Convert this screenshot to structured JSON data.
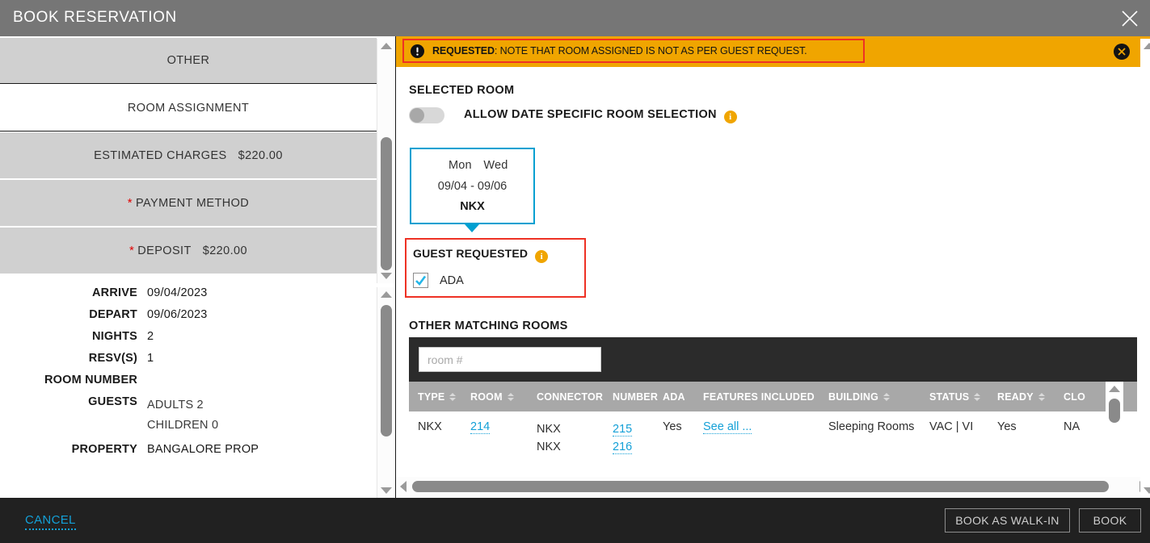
{
  "window": {
    "title": "BOOK RESERVATION",
    "close_icon": "close-icon"
  },
  "left_panel": {
    "sections": [
      {
        "label": "OTHER",
        "style": "grey",
        "amount": "",
        "required": false
      },
      {
        "label": "ROOM ASSIGNMENT",
        "style": "white",
        "amount": "",
        "required": false
      },
      {
        "label": "ESTIMATED CHARGES",
        "style": "grey",
        "amount": "$220.00",
        "required": false
      },
      {
        "label": "PAYMENT METHOD",
        "style": "grey",
        "amount": "",
        "required": true
      },
      {
        "label": "DEPOSIT",
        "style": "grey",
        "amount": "$220.00",
        "required": true
      }
    ],
    "details": [
      {
        "label": "ARRIVE",
        "value": "09/04/2023"
      },
      {
        "label": "DEPART",
        "value": "09/06/2023"
      },
      {
        "label": "NIGHTS",
        "value": "2"
      },
      {
        "label": "RESV(S)",
        "value": "1"
      },
      {
        "label": "ROOM NUMBER",
        "value": ""
      },
      {
        "label": "GUESTS",
        "value": "ADULTS 2",
        "value2": "CHILDREN 0"
      },
      {
        "label": "PROPERTY",
        "value": "BANGALORE PROP"
      }
    ]
  },
  "alert": {
    "icon": "exclamation-icon",
    "label": "REQUESTED",
    "separator": ": ",
    "message": "NOTE THAT ROOM ASSIGNED IS NOT AS PER GUEST REQUEST.",
    "dismiss_icon": "close-circle-icon",
    "background": "#f0a500",
    "outline": "#ee3124"
  },
  "selected_room": {
    "heading": "SELECTED ROOM",
    "toggle_label": "ALLOW DATE SPECIFIC ROOM SELECTION",
    "toggle_state": "off",
    "toggle_info_icon": "info-icon",
    "card": {
      "day_start": "Mon",
      "day_end": "Wed",
      "date_range": "09/04 - 09/06",
      "room_type": "NKX",
      "border_color": "#00a0d1"
    }
  },
  "guest_requested": {
    "heading": "GUEST REQUESTED",
    "info_icon": "info-icon",
    "checkbox_label": "ADA",
    "checkbox_checked": true,
    "outline": "#ee3124"
  },
  "other_matching_rooms": {
    "heading": "OTHER MATCHING ROOMS",
    "search": {
      "placeholder": "room #",
      "value": ""
    },
    "columns": [
      {
        "label": "TYPE",
        "sortable": true
      },
      {
        "label": "ROOM",
        "sortable": true
      },
      {
        "label": "CONNECTOR",
        "sortable": false
      },
      {
        "label": "NUMBER",
        "sortable": false
      },
      {
        "label": "ADA",
        "sortable": false
      },
      {
        "label": "FEATURES INCLUDED",
        "sortable": false
      },
      {
        "label": "BUILDING",
        "sortable": true
      },
      {
        "label": "STATUS",
        "sortable": true
      },
      {
        "label": "READY",
        "sortable": true
      },
      {
        "label": "CLO",
        "sortable": false
      }
    ],
    "rows": [
      {
        "type": "NKX",
        "room": "214",
        "connector_1": "NKX",
        "connector_2": "NKX",
        "number_1": "215",
        "number_2": "216",
        "ada": "Yes",
        "features": "See all ...",
        "building": "Sleeping Rooms",
        "status": "VAC | VI",
        "ready": "Yes",
        "closed": "NA"
      }
    ]
  },
  "footer": {
    "cancel_label": "CANCEL",
    "walkin_label": "BOOK AS WALK-IN",
    "book_label": "BOOK"
  }
}
